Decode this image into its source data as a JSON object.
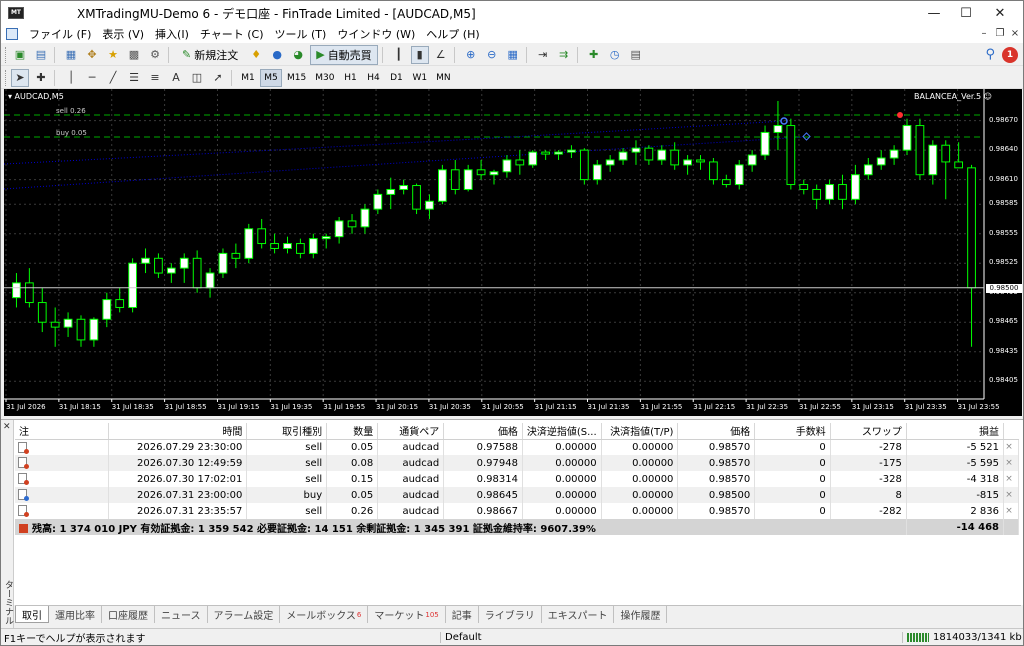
{
  "window": {
    "title": "XMTradingMU-Demo 6 - デモ口座 - FinTrade Limited - [AUDCAD,M5]",
    "app_icon_text": "MT"
  },
  "menu": [
    "ファイル (F)",
    "表示 (V)",
    "挿入(I)",
    "チャート (C)",
    "ツール (T)",
    "ウインドウ (W)",
    "ヘルプ (H)"
  ],
  "toolbar": {
    "new_order_label": "新規注文",
    "auto_trading_label": "自動売買",
    "notification_count": "1"
  },
  "timeframes": [
    "M1",
    "M5",
    "M15",
    "M30",
    "H1",
    "H4",
    "D1",
    "W1",
    "MN"
  ],
  "active_timeframe": "M5",
  "chart": {
    "symbol_label": "▾ AUDCAD,M5",
    "ea_label": "BALANCEA_Ver.5 ☺",
    "current_price": "0.98500",
    "sell_line_label": "sell 0.26",
    "buy_line_label": "buy 0.05",
    "price_axis": [
      "0.98670",
      "0.98640",
      "0.98610",
      "0.98585",
      "0.98555",
      "0.98525",
      "0.98495",
      "0.98465",
      "0.98435",
      "0.98405"
    ],
    "time_axis": [
      "31 Jul 2026",
      "31 Jul 18:15",
      "31 Jul 18:35",
      "31 Jul 18:55",
      "31 Jul 19:15",
      "31 Jul 19:35",
      "31 Jul 19:55",
      "31 Jul 20:15",
      "31 Jul 20:35",
      "31 Jul 20:55",
      "31 Jul 21:15",
      "31 Jul 21:35",
      "31 Jul 21:55",
      "31 Jul 22:15",
      "31 Jul 22:35",
      "31 Jul 22:55",
      "31 Jul 23:15",
      "31 Jul 23:35",
      "31 Jul 23:55"
    ],
    "colors": {
      "bull": "#ffffff",
      "bear": "#000000",
      "wick": "#00ff00",
      "grid": "#3a3a3a",
      "sell_line": "#0000cc",
      "buy_line": "#00aa00"
    },
    "price_min": 0.98392,
    "price_max": 0.98692,
    "candles": [
      [
        0.9849,
        0.98515,
        0.9848,
        0.98505
      ],
      [
        0.98505,
        0.9852,
        0.9848,
        0.98485
      ],
      [
        0.98485,
        0.985,
        0.98455,
        0.98465
      ],
      [
        0.98465,
        0.9848,
        0.9844,
        0.9846
      ],
      [
        0.9846,
        0.98475,
        0.9845,
        0.98468
      ],
      [
        0.98468,
        0.98472,
        0.9844,
        0.98447
      ],
      [
        0.98447,
        0.9847,
        0.9844,
        0.98468
      ],
      [
        0.98468,
        0.98495,
        0.9846,
        0.98488
      ],
      [
        0.98488,
        0.985,
        0.98475,
        0.9848
      ],
      [
        0.9848,
        0.9853,
        0.98475,
        0.98525
      ],
      [
        0.98525,
        0.9854,
        0.98515,
        0.9853
      ],
      [
        0.9853,
        0.98535,
        0.9851,
        0.98515
      ],
      [
        0.98515,
        0.98525,
        0.98505,
        0.9852
      ],
      [
        0.9852,
        0.98535,
        0.98505,
        0.9853
      ],
      [
        0.9853,
        0.98538,
        0.98495,
        0.985
      ],
      [
        0.985,
        0.9852,
        0.9849,
        0.98515
      ],
      [
        0.98515,
        0.9854,
        0.9851,
        0.98535
      ],
      [
        0.98535,
        0.98545,
        0.9852,
        0.9853
      ],
      [
        0.9853,
        0.98565,
        0.98525,
        0.9856
      ],
      [
        0.9856,
        0.9857,
        0.9854,
        0.98545
      ],
      [
        0.98545,
        0.98555,
        0.98535,
        0.9854
      ],
      [
        0.9854,
        0.98552,
        0.98535,
        0.98545
      ],
      [
        0.98545,
        0.9855,
        0.9853,
        0.98535
      ],
      [
        0.98535,
        0.98555,
        0.9853,
        0.9855
      ],
      [
        0.9855,
        0.98555,
        0.9854,
        0.98552
      ],
      [
        0.98552,
        0.98572,
        0.98545,
        0.98568
      ],
      [
        0.98568,
        0.98575,
        0.98555,
        0.98562
      ],
      [
        0.98562,
        0.98585,
        0.98555,
        0.9858
      ],
      [
        0.9858,
        0.986,
        0.98575,
        0.98595
      ],
      [
        0.98595,
        0.98612,
        0.9858,
        0.986
      ],
      [
        0.986,
        0.9861,
        0.98595,
        0.98604
      ],
      [
        0.98604,
        0.98606,
        0.98575,
        0.9858
      ],
      [
        0.9858,
        0.98595,
        0.9857,
        0.98588
      ],
      [
        0.98588,
        0.98625,
        0.98585,
        0.9862
      ],
      [
        0.9862,
        0.9863,
        0.98595,
        0.986
      ],
      [
        0.986,
        0.98625,
        0.98598,
        0.9862
      ],
      [
        0.9862,
        0.9863,
        0.9861,
        0.98615
      ],
      [
        0.98615,
        0.9862,
        0.98605,
        0.98618
      ],
      [
        0.98618,
        0.98635,
        0.98612,
        0.9863
      ],
      [
        0.9863,
        0.9864,
        0.98615,
        0.98625
      ],
      [
        0.98625,
        0.9864,
        0.98622,
        0.98638
      ],
      [
        0.98638,
        0.9864,
        0.9863,
        0.98636
      ],
      [
        0.98636,
        0.9864,
        0.9863,
        0.98638
      ],
      [
        0.98638,
        0.98645,
        0.98632,
        0.9864
      ],
      [
        0.9864,
        0.98642,
        0.98605,
        0.9861
      ],
      [
        0.9861,
        0.9863,
        0.98605,
        0.98625
      ],
      [
        0.98625,
        0.98635,
        0.98618,
        0.9863
      ],
      [
        0.9863,
        0.98642,
        0.98625,
        0.98638
      ],
      [
        0.98638,
        0.9865,
        0.98625,
        0.98642
      ],
      [
        0.98642,
        0.98645,
        0.98625,
        0.9863
      ],
      [
        0.9863,
        0.98645,
        0.98625,
        0.9864
      ],
      [
        0.9864,
        0.98648,
        0.9862,
        0.98625
      ],
      [
        0.98625,
        0.98635,
        0.98615,
        0.9863
      ],
      [
        0.9863,
        0.98635,
        0.9862,
        0.98628
      ],
      [
        0.98628,
        0.98632,
        0.98605,
        0.9861
      ],
      [
        0.9861,
        0.98615,
        0.98602,
        0.98605
      ],
      [
        0.98605,
        0.9863,
        0.986,
        0.98625
      ],
      [
        0.98625,
        0.9864,
        0.98618,
        0.98635
      ],
      [
        0.98635,
        0.98665,
        0.9863,
        0.98658
      ],
      [
        0.98658,
        0.9869,
        0.9864,
        0.98665
      ],
      [
        0.98665,
        0.98672,
        0.986,
        0.98605
      ],
      [
        0.98605,
        0.9861,
        0.98595,
        0.986
      ],
      [
        0.986,
        0.98605,
        0.9858,
        0.9859
      ],
      [
        0.9859,
        0.9861,
        0.98585,
        0.98605
      ],
      [
        0.98605,
        0.98615,
        0.9858,
        0.9859
      ],
      [
        0.9859,
        0.98625,
        0.98585,
        0.98615
      ],
      [
        0.98615,
        0.98632,
        0.9861,
        0.98625
      ],
      [
        0.98625,
        0.9864,
        0.9862,
        0.98632
      ],
      [
        0.98632,
        0.98645,
        0.98625,
        0.9864
      ],
      [
        0.9864,
        0.98672,
        0.98635,
        0.98665
      ],
      [
        0.98665,
        0.98672,
        0.9861,
        0.98615
      ],
      [
        0.98615,
        0.9865,
        0.98605,
        0.98645
      ],
      [
        0.98645,
        0.9865,
        0.9859,
        0.98628
      ],
      [
        0.98628,
        0.98648,
        0.98625,
        0.98622
      ],
      [
        0.98622,
        0.98625,
        0.9844,
        0.985
      ]
    ]
  },
  "terminal": {
    "side_label": "ターミナル",
    "headers": [
      "注",
      "時間",
      "取引種別",
      "数量",
      "通貨ペア",
      "価格",
      "決済逆指値(S...",
      "決済指値(T/P)",
      "価格",
      "手数料",
      "スワップ",
      "損益"
    ],
    "rows": [
      {
        "icon": "sell",
        "time": "2026.07.29 23:30:00",
        "type": "sell",
        "volume": "0.05",
        "symbol": "audcad",
        "price": "0.97588",
        "sl": "0.00000",
        "tp": "0.00000",
        "cur_price": "0.98570",
        "commission": "0",
        "swap": "-278",
        "profit": "-5 521"
      },
      {
        "icon": "sell",
        "time": "2026.07.30 12:49:59",
        "type": "sell",
        "volume": "0.08",
        "symbol": "audcad",
        "price": "0.97948",
        "sl": "0.00000",
        "tp": "0.00000",
        "cur_price": "0.98570",
        "commission": "0",
        "swap": "-175",
        "profit": "-5 595"
      },
      {
        "icon": "sell",
        "time": "2026.07.30 17:02:01",
        "type": "sell",
        "volume": "0.15",
        "symbol": "audcad",
        "price": "0.98314",
        "sl": "0.00000",
        "tp": "0.00000",
        "cur_price": "0.98570",
        "commission": "0",
        "swap": "-328",
        "profit": "-4 318"
      },
      {
        "icon": "buy",
        "time": "2026.07.31 23:00:00",
        "type": "buy",
        "volume": "0.05",
        "symbol": "audcad",
        "price": "0.98645",
        "sl": "0.00000",
        "tp": "0.00000",
        "cur_price": "0.98500",
        "commission": "0",
        "swap": "8",
        "profit": "-815"
      },
      {
        "icon": "sell",
        "time": "2026.07.31 23:35:57",
        "type": "sell",
        "volume": "0.26",
        "symbol": "audcad",
        "price": "0.98667",
        "sl": "0.00000",
        "tp": "0.00000",
        "cur_price": "0.98570",
        "commission": "0",
        "swap": "-282",
        "profit": "2 836"
      }
    ],
    "summary_text": "残高: 1 374 010 JPY  有効証拠金: 1 359 542  必要証拠金: 14 151  余剰証拠金: 1 345 391  証拠金維持率: 9607.39%",
    "summary_total": "-14 468",
    "tabs": [
      {
        "label": "取引",
        "badge": ""
      },
      {
        "label": "運用比率",
        "badge": ""
      },
      {
        "label": "口座履歴",
        "badge": ""
      },
      {
        "label": "ニュース",
        "badge": ""
      },
      {
        "label": "アラーム設定",
        "badge": ""
      },
      {
        "label": "メールボックス",
        "badge": "6"
      },
      {
        "label": "マーケット",
        "badge": "105"
      },
      {
        "label": "記事",
        "badge": ""
      },
      {
        "label": "ライブラリ",
        "badge": ""
      },
      {
        "label": "エキスパート",
        "badge": ""
      },
      {
        "label": "操作履歴",
        "badge": ""
      }
    ]
  },
  "status": {
    "help": "F1キーでヘルプが表示されます",
    "profile": "Default",
    "connection": "1814033/1341 kb"
  }
}
